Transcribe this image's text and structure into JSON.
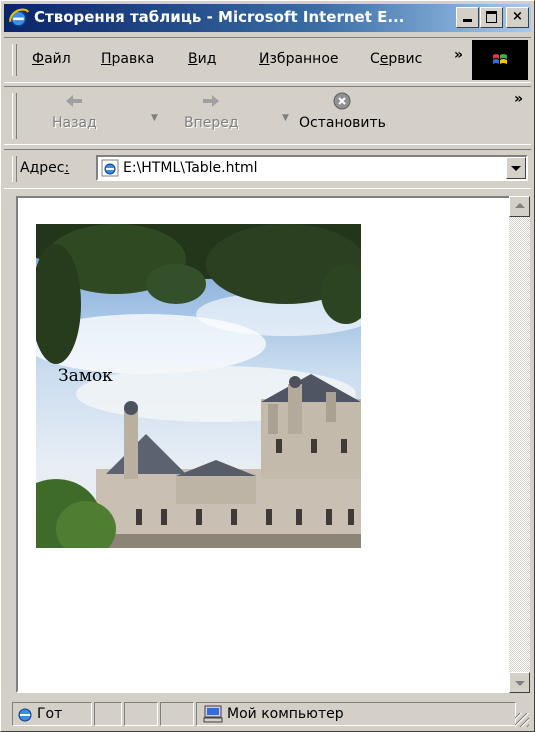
{
  "window": {
    "title": "Створення таблиць - Microsoft Internet E...",
    "controls": {
      "minimize": "minimize",
      "maximize": "maximize",
      "close": "×"
    }
  },
  "menu": {
    "items": [
      {
        "label": "Файл",
        "underline": "Ф",
        "rest": "айл"
      },
      {
        "label": "Правка",
        "underline": "П",
        "rest": "равка"
      },
      {
        "label": "Вид",
        "underline": "В",
        "rest": "ид"
      },
      {
        "label": "Избранное",
        "underline": "И",
        "rest": "збранное"
      },
      {
        "label": "Сервис",
        "pre": "С",
        "underline": "е",
        "rest": "рвис"
      }
    ],
    "overflow": "»"
  },
  "toolbar": {
    "back_label": "Назад",
    "forward_label": "Вперед",
    "stop_label": "Остановить",
    "overflow": "»"
  },
  "address": {
    "label": "Адрес",
    "underline_char": ":",
    "value": "E:\\HTML\\Table.html"
  },
  "page": {
    "image_caption": "Замок"
  },
  "status": {
    "text": "Гот",
    "zone": "Мой компьютер"
  },
  "colors": {
    "titlebar_start": "#0a246a",
    "titlebar_end": "#a6caf0",
    "chrome": "#d4d0c8"
  }
}
